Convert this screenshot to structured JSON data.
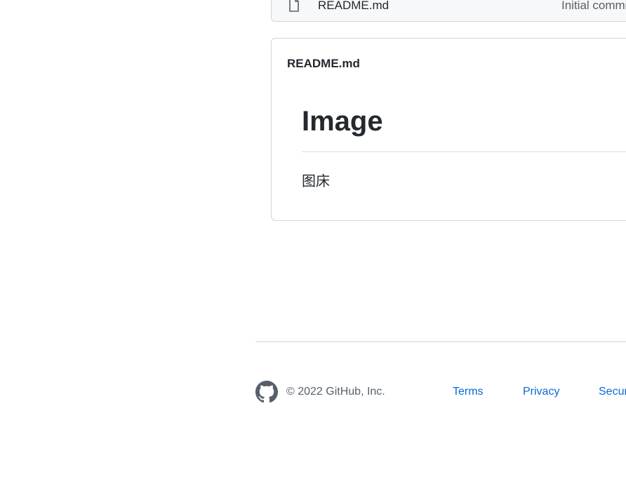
{
  "file_list": {
    "rows": [
      {
        "name": "README.md",
        "icon": "file-icon",
        "commit_message": "Initial commit"
      }
    ]
  },
  "readme": {
    "header": "README.md",
    "heading": "Image",
    "paragraph": "图床"
  },
  "footer": {
    "logo": "github-logo-icon",
    "copyright": "© 2022 GitHub, Inc.",
    "links": [
      {
        "label": "Terms"
      },
      {
        "label": "Privacy"
      },
      {
        "label": "Security"
      }
    ]
  },
  "colors": {
    "border": "#d0d7de",
    "link": "#0969da",
    "muted": "#57606a",
    "text": "#24292f",
    "row_bg": "#f6f8fa"
  }
}
